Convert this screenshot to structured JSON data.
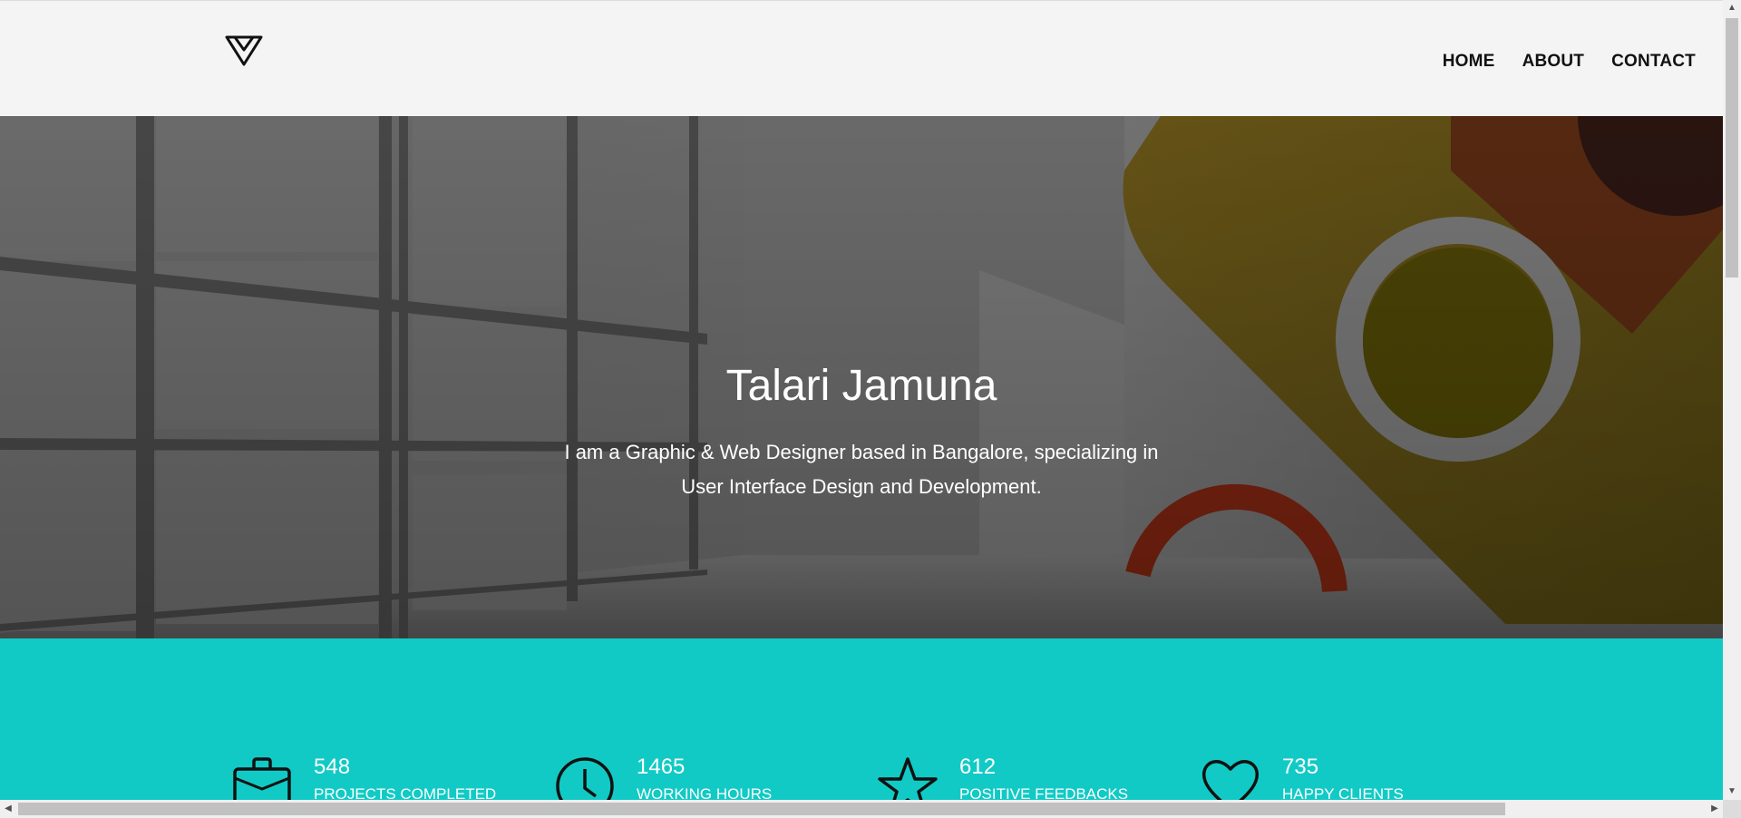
{
  "header": {
    "logo": "triangle-logo-icon",
    "nav": [
      {
        "label": "HOME"
      },
      {
        "label": "ABOUT"
      },
      {
        "label": "CONTACT"
      }
    ]
  },
  "hero": {
    "title": "Talari Jamuna",
    "text": "I am a Graphic & Web Designer based in Bangalore, specializing in User Interface Design and Development."
  },
  "stats": {
    "background": "#11cac5",
    "items": [
      {
        "icon": "briefcase-icon",
        "value": "548",
        "label": "PROJECTS COMPLETED"
      },
      {
        "icon": "clock-icon",
        "value": "1465",
        "label": "WORKING HOURS"
      },
      {
        "icon": "star-icon",
        "value": "612",
        "label": "POSITIVE FEEDBACKS"
      },
      {
        "icon": "heart-icon",
        "value": "735",
        "label": "HAPPY CLIENTS"
      }
    ]
  }
}
